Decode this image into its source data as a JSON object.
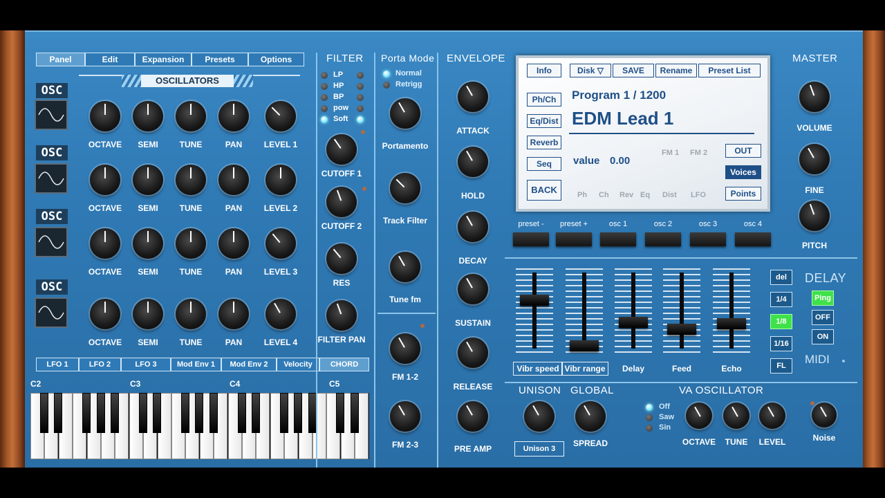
{
  "tabs": [
    {
      "label": "Panel",
      "active": true
    },
    {
      "label": "Edit"
    },
    {
      "label": "Expansion"
    },
    {
      "label": "Presets"
    },
    {
      "label": "Options"
    }
  ],
  "oscillators": {
    "title": "OSCILLATORS",
    "osc_word": "OSC",
    "knob_labels": [
      "OCTAVE",
      "SEMI",
      "TUNE",
      "PAN"
    ],
    "level_labels": [
      "LEVEL 1",
      "LEVEL 2",
      "LEVEL 3",
      "LEVEL 4"
    ]
  },
  "bottom_tabs": [
    {
      "label": "LFO 1"
    },
    {
      "label": "LFO 2"
    },
    {
      "label": "LFO 3"
    },
    {
      "label": "Mod Env 1"
    },
    {
      "label": "Mod Env 2"
    },
    {
      "label": "Velocity"
    },
    {
      "label": "CHORD",
      "active": true
    }
  ],
  "keyboard": {
    "octave_labels": [
      "C2",
      "C3",
      "C4",
      "C5"
    ]
  },
  "filter": {
    "title": "FILTER",
    "types": [
      "LP",
      "HP",
      "BP",
      "pow",
      "Soft"
    ],
    "selected": "Soft",
    "knobs": [
      "CUTOFF 1",
      "CUTOFF 2",
      "RES",
      "FILTER PAN"
    ]
  },
  "porta": {
    "title": "Porta Mode",
    "modes": [
      "Normal",
      "Retrigg"
    ],
    "selected": "Normal",
    "knobs": [
      "Portamento",
      "Track Filter",
      "Tune fm"
    ],
    "fm_knobs": [
      "FM 1-2",
      "FM 2-3"
    ]
  },
  "envelope": {
    "title": "ENVELOPE",
    "knobs": [
      "ATTACK",
      "HOLD",
      "DECAY",
      "SUSTAIN",
      "RELEASE",
      "PRE AMP"
    ]
  },
  "screen": {
    "top_buttons": [
      "Info",
      "Disk",
      "SAVE",
      "Rename",
      "Preset List"
    ],
    "disk_arrow": "▽",
    "left_buttons": [
      "Ph/Ch",
      "Eq/Dist",
      "Reverb",
      "Seq"
    ],
    "back": "BACK",
    "program": "Program 1 / 1200",
    "preset_name": "EDM Lead 1",
    "value_label": "value",
    "value": "0.00",
    "fm_labels": [
      "FM 1",
      "FM 2"
    ],
    "right_buttons": [
      "OUT",
      "Voices",
      "Points"
    ],
    "bottom_labels": [
      "Ph",
      "Ch",
      "Rev",
      "Eq",
      "Dist",
      "LFO"
    ]
  },
  "pads": {
    "labels": [
      "preset -",
      "preset +",
      "osc 1",
      "osc 2",
      "osc 3",
      "osc 4"
    ]
  },
  "faders": {
    "labels": [
      "Vibr speed",
      "Vibr range",
      "Delay",
      "Feed",
      "Echo"
    ],
    "boxed": [
      true,
      true,
      false,
      false,
      false
    ]
  },
  "delay": {
    "title": "DELAY",
    "buttons": [
      "del",
      "1/4",
      "1/8",
      "1/16",
      "FL"
    ],
    "selected": "1/8",
    "mode_buttons": [
      "Ping",
      "OFF",
      "ON"
    ],
    "midi": "MIDI"
  },
  "master": {
    "title": "MASTER",
    "knobs": [
      "VOLUME",
      "FINE",
      "PITCH"
    ]
  },
  "unison": {
    "title": "UNISON",
    "value": "Unison 3"
  },
  "global": {
    "title": "GLOBAL",
    "knob": "SPREAD"
  },
  "va": {
    "title": "VA OSCILLATOR",
    "waves": [
      "Off",
      "Saw",
      "Sin"
    ],
    "selected": "Off",
    "knobs": [
      "OCTAVE",
      "TUNE",
      "LEVEL"
    ],
    "noise": "Noise"
  }
}
